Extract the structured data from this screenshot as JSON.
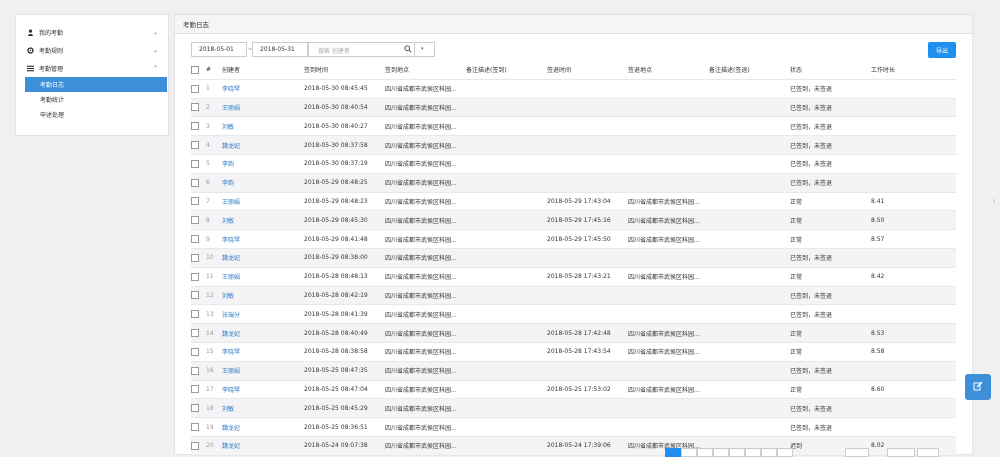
{
  "sidebar": {
    "items": [
      {
        "label": "我的考勤",
        "icon": "user-icon",
        "chevron": "⌄"
      },
      {
        "label": "考勤规则",
        "icon": "gear-icon",
        "chevron": "⌄"
      },
      {
        "label": "考勤管理",
        "icon": "list-icon",
        "chevron": "⌃"
      }
    ],
    "sub_items": [
      {
        "label": "考勤日志",
        "active": true
      },
      {
        "label": "考勤统计",
        "active": false
      },
      {
        "label": "申述处理",
        "active": false
      }
    ]
  },
  "main": {
    "title": "考勤日志",
    "start_date": "2018-05-01",
    "date_separator": "~",
    "end_date": "2018-05-31",
    "search_placeholder": "搜索 创建者",
    "export_label": "导出"
  },
  "table": {
    "headers": [
      "#",
      "创建者",
      "签到时间",
      "签到地点",
      "备注描述(签到)",
      "签退时间",
      "签退地点",
      "备注描述(签退)",
      "状态",
      "工作时长"
    ],
    "rows": [
      [
        "1",
        "李晓琴",
        "2018-05-30 08:45:45",
        "四川省成都市武侯区科园...",
        "",
        "",
        "",
        "",
        "已签到，未签退",
        ""
      ],
      [
        "2",
        "王丽娟",
        "2018-05-30 08:40:54",
        "四川省成都市武侯区科园...",
        "",
        "",
        "",
        "",
        "已签到，未签退",
        ""
      ],
      [
        "3",
        "刘敏",
        "2018-05-30 08:40:27",
        "四川省成都市武侯区科园...",
        "",
        "",
        "",
        "",
        "已签到，未签退",
        ""
      ],
      [
        "4",
        "魏龙妃",
        "2018-05-30 08:37:58",
        "四川省成都市武侯区科园...",
        "",
        "",
        "",
        "",
        "已签到，未签退",
        ""
      ],
      [
        "5",
        "李韵",
        "2018-05-30 08:37:19",
        "四川省成都市武侯区科园...",
        "",
        "",
        "",
        "",
        "已签到，未签退",
        ""
      ],
      [
        "6",
        "李韵",
        "2018-05-29 08:48:25",
        "四川省成都市武侯区科园...",
        "",
        "",
        "",
        "",
        "已签到，未签退",
        ""
      ],
      [
        "7",
        "王丽娟",
        "2018-05-29 08:48:23",
        "四川省成都市武侯区科园...",
        "",
        "2018-05-29 17:43:04",
        "四川省成都市武侯区科园...",
        "",
        "正常",
        "8.41"
      ],
      [
        "8",
        "刘敏",
        "2018-05-29 08:45:30",
        "四川省成都市武侯区科园...",
        "",
        "2018-05-29 17:45:16",
        "四川省成都市武侯区科园...",
        "",
        "正常",
        "8.50"
      ],
      [
        "9",
        "李晓琴",
        "2018-05-29 08:41:48",
        "四川省成都市武侯区科园...",
        "",
        "2018-05-29 17:45:50",
        "四川省成都市武侯区科园...",
        "",
        "正常",
        "8.57"
      ],
      [
        "10",
        "魏龙妃",
        "2018-05-29 08:38:00",
        "四川省成都市武侯区科园...",
        "",
        "",
        "",
        "",
        "已签到，未签退",
        ""
      ],
      [
        "11",
        "王丽娟",
        "2018-05-28 08:48:13",
        "四川省成都市武侯区科园...",
        "",
        "2018-05-28 17:43:21",
        "四川省成都市武侯区科园...",
        "",
        "正常",
        "8.42"
      ],
      [
        "12",
        "刘敏",
        "2018-05-28 08:42:19",
        "四川省成都市武侯区科园...",
        "",
        "",
        "",
        "",
        "已签到，未签退",
        ""
      ],
      [
        "13",
        "张瑞分",
        "2018-05-28 08:41:39",
        "四川省成都市武侯区科园...",
        "",
        "",
        "",
        "",
        "已签到，未签退",
        ""
      ],
      [
        "14",
        "魏龙妃",
        "2018-05-28 08:40:49",
        "四川省成都市武侯区科园...",
        "",
        "2018-05-28 17:42:48",
        "四川省成都市武侯区科园...",
        "",
        "正常",
        "8.53"
      ],
      [
        "15",
        "李晓琴",
        "2018-05-28 08:38:58",
        "四川省成都市武侯区科园...",
        "",
        "2018-05-28 17:43:54",
        "四川省成都市武侯区科园...",
        "",
        "正常",
        "8.58"
      ],
      [
        "16",
        "王丽娟",
        "2018-05-25 08:47:35",
        "四川省成都市武侯区科园...",
        "",
        "",
        "",
        "",
        "已签到，未签退",
        ""
      ],
      [
        "17",
        "李晓琴",
        "2018-05-25 08:47:04",
        "四川省成都市武侯区科园...",
        "",
        "2018-05-25 17:53:02",
        "四川省成都市武侯区科园...",
        "",
        "正常",
        "8.60"
      ],
      [
        "18",
        "刘敏",
        "2018-05-25 08:45:29",
        "四川省成都市武侯区科园...",
        "",
        "",
        "",
        "",
        "已签到，未签退",
        ""
      ],
      [
        "19",
        "魏龙妃",
        "2018-05-25 08:36:51",
        "四川省成都市武侯区科园...",
        "",
        "",
        "",
        "",
        "已签到，未签退",
        ""
      ],
      [
        "20",
        "魏龙妃",
        "2018-05-24 09:07:38",
        "四川省成都市武侯区科园...",
        "",
        "2018-05-24 17:39:06",
        "四川省成都市武侯区科园...",
        "",
        "迟到",
        "8.02"
      ]
    ]
  },
  "colors": {
    "accent": "#1e90f0",
    "sidebar_active": "#3d8fd9",
    "link": "#2b7ac7"
  }
}
